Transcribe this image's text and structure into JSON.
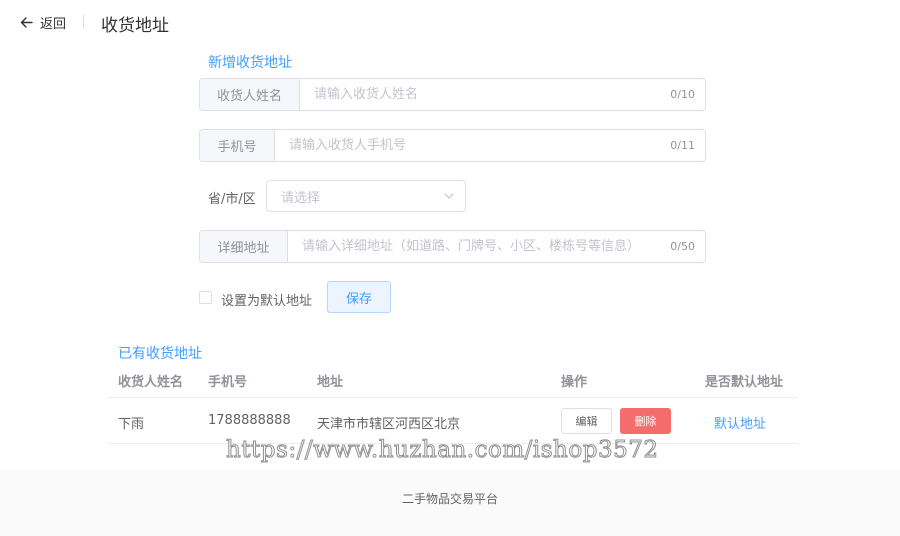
{
  "header": {
    "back_label": "返回",
    "title": "收货地址"
  },
  "form": {
    "title": "新增收货地址",
    "name": {
      "label": "收货人姓名",
      "value": "",
      "placeholder": "请输入收货人姓名",
      "count": "0/10"
    },
    "phone": {
      "label": "手机号",
      "value": "",
      "placeholder": "请输入收货人手机号",
      "count": "0/11"
    },
    "region": {
      "label": "省/市/区",
      "placeholder": "请选择"
    },
    "detail": {
      "label": "详细地址",
      "value": "",
      "placeholder": "请输入详细地址（如道路、门牌号、小区、楼栋号等信息）",
      "count": "0/50"
    },
    "default_checkbox_label": "设置为默认地址",
    "default_checked": false,
    "save_label": "保存"
  },
  "list": {
    "title": "已有收货地址",
    "columns": [
      "收货人姓名",
      "手机号",
      "地址",
      "操作",
      "是否默认地址"
    ],
    "rows": [
      {
        "name": "下雨",
        "phone": "1788888888",
        "address": "天津市市辖区河西区北京",
        "edit_label": "编辑",
        "delete_label": "删除",
        "default_label": "默认地址"
      }
    ]
  },
  "watermark": "https://www.huzhan.com/ishop3572",
  "footer": {
    "text": "二手物品交易平台"
  },
  "colors": {
    "accent": "#409eff",
    "danger": "#f56c6c",
    "border": "#dcdfe6",
    "muted": "#909399"
  }
}
